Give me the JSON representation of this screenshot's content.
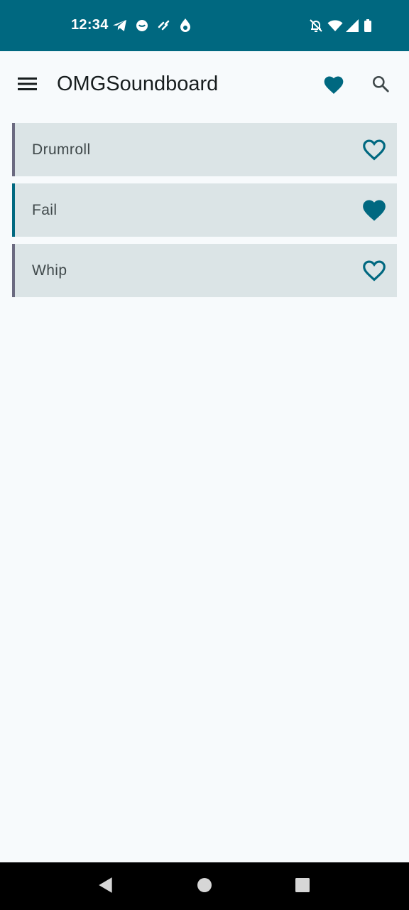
{
  "status_bar": {
    "time": "12:34",
    "background": "#006880"
  },
  "app_bar": {
    "title": "OMGSoundboard"
  },
  "sounds": [
    {
      "label": "Drumroll",
      "favorite": false
    },
    {
      "label": "Fail",
      "favorite": true
    },
    {
      "label": "Whip",
      "favorite": false
    }
  ],
  "colors": {
    "accent": "#006880",
    "item_background": "#dbe4e6",
    "page_background": "#f7fafc"
  },
  "icons": {
    "menu": "hamburger-menu-icon",
    "favorites": "heart-filled-icon",
    "search": "search-icon",
    "favorite_on": "heart-filled-icon",
    "favorite_off": "heart-outline-icon"
  }
}
